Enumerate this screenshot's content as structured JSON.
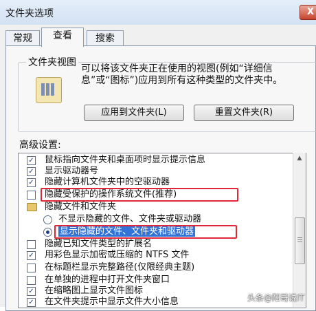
{
  "window": {
    "title": "文件夹选项",
    "close_glyph": "X"
  },
  "tabs": [
    {
      "label": "常规"
    },
    {
      "label": "查看"
    },
    {
      "label": "搜索"
    }
  ],
  "folder_view": {
    "group_title": "文件夹视图",
    "description": "可以将该文件夹正在使用的视图(例如“详细信息”或“图标”)应用到所有这种类型的文件夹中。",
    "apply_button": "应用到文件夹(L)",
    "reset_button": "重置文件夹(R)"
  },
  "advanced": {
    "label": "高级设置:",
    "items": [
      {
        "type": "checkbox",
        "checked": true,
        "label": "鼠标指向文件夹和桌面项时显示提示信息"
      },
      {
        "type": "checkbox",
        "checked": true,
        "label": "显示驱动器号"
      },
      {
        "type": "checkbox",
        "checked": true,
        "label": "隐藏计算机文件夹中的空驱动器"
      },
      {
        "type": "checkbox",
        "checked": false,
        "label": "隐藏受保护的操作系统文件(推荐)"
      },
      {
        "type": "folder",
        "label": "隐藏文件和文件夹"
      },
      {
        "type": "radio",
        "selected": false,
        "label": "不显示隐藏的文件、文件夹或驱动器"
      },
      {
        "type": "radio",
        "selected": true,
        "label": "显示隐藏的文件、文件夹和驱动器"
      },
      {
        "type": "checkbox",
        "checked": false,
        "label": "隐藏已知文件类型的扩展名"
      },
      {
        "type": "checkbox",
        "checked": true,
        "label": "用彩色显示加密或压缩的 NTFS 文件"
      },
      {
        "type": "checkbox",
        "checked": false,
        "label": "在标题栏显示完整路径(仅限经典主题)"
      },
      {
        "type": "checkbox",
        "checked": false,
        "label": "在单独的进程中打开文件夹窗口"
      },
      {
        "type": "checkbox",
        "checked": true,
        "label": "在缩略图上显示文件图标"
      },
      {
        "type": "checkbox",
        "checked": true,
        "label": "在文件夹提示中显示文件大小信息"
      }
    ]
  },
  "scrollbar": {
    "up_glyph": "▲"
  },
  "watermark": "头条@阳哥说IT",
  "colors": {
    "highlight_border": "#e1263a",
    "selection": "#3173d6"
  }
}
